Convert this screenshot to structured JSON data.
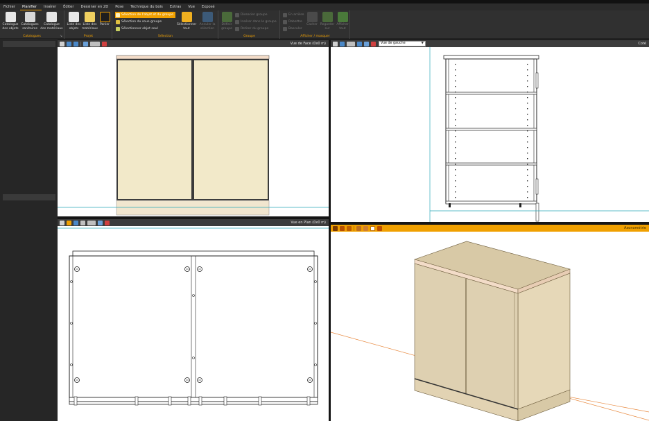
{
  "menu": {
    "items": [
      {
        "label": "Fichier",
        "active": false
      },
      {
        "label": "Planifier",
        "active": true
      },
      {
        "label": "Insérer",
        "active": false
      },
      {
        "label": "Éditer",
        "active": false
      },
      {
        "label": "Dessiner en 2D",
        "active": false
      },
      {
        "label": "Pose",
        "active": false
      },
      {
        "label": "Technique du bois",
        "active": false
      },
      {
        "label": "Extras",
        "active": false
      },
      {
        "label": "Vue",
        "active": false
      },
      {
        "label": "Exposé",
        "active": false
      }
    ]
  },
  "ribbon": {
    "catalogues": {
      "group_label": "Catalogues",
      "objects_label_1": "Catalogue",
      "objects_label_2": "des objets",
      "sanitary_label_1": "Catalogues",
      "sanitary_label_2": "sanitaires",
      "materials_label_1": "Catalogue",
      "materials_label_2": "des matériaux"
    },
    "projet": {
      "group_label": "Projet",
      "objects_list_1": "Liste des",
      "objects_list_2": "objets",
      "materials_list_1": "Liste des",
      "materials_list_2": "matériaux",
      "cart_label": "Panier"
    },
    "selection": {
      "group_label": "Sélection",
      "select_object_group": "Sélection de l'objet et du groupe",
      "select_subgroup": "Sélection du sous-groupe",
      "select_object_only": "Sélectionner objet seul",
      "select_all_1": "Sélectionner",
      "select_all_2": "tout",
      "cancel_selection_1": "Annuler la",
      "cancel_selection_2": "sélection"
    },
    "groupe": {
      "group_label": "Groupe",
      "define_group_1": "Définir",
      "define_group_2": "groupe",
      "dissolve_group": "Dissocier groupe",
      "insert_in_group": "Insérer dans le groupe",
      "remove_from_group": "Retirer du groupe"
    },
    "afficher": {
      "group_label": "Afficher / masquer",
      "send_back": "En arrière",
      "fold": "Rabattre",
      "flip": "Basculer",
      "hide": "Cacher",
      "look_at_1": "Regarder",
      "look_at_2": "sur",
      "show_all_1": "Afficher",
      "show_all_2": "tout"
    }
  },
  "viewports": {
    "front": {
      "title": "Vue de Face  (0x0 m)"
    },
    "left": {
      "select_value": "Vue de gauche",
      "right_title": "Coté"
    },
    "plan": {
      "title": "Vue en Plan  (0x0 m)"
    },
    "iso": {
      "title": "Axonométrie"
    }
  },
  "colors": {
    "accent": "#f0a000",
    "door_fill": "#f2e9c9",
    "top_panel": "#f3dcc8",
    "plinth": "#f1e6cf",
    "cyan_line": "#2aa8b8",
    "iso_front": "#ded0b1",
    "iso_side": "#e6d8b8",
    "iso_top": "#d8c9a6"
  }
}
